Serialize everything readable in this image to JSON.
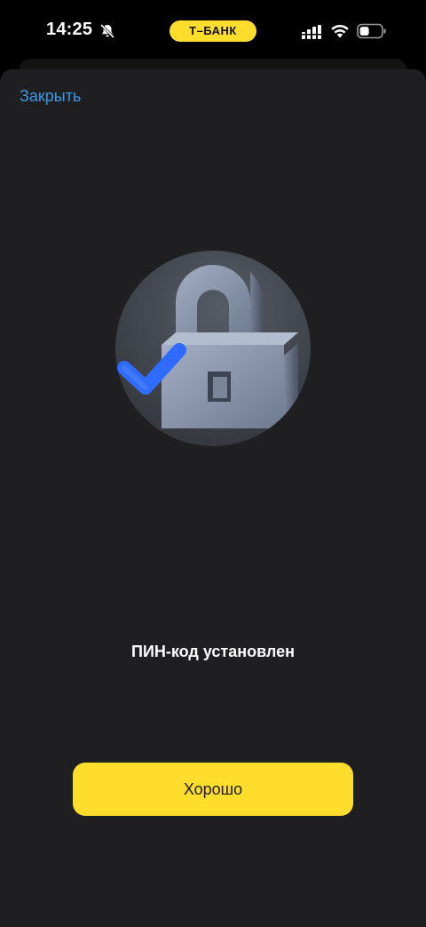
{
  "status_bar": {
    "time": "14:25",
    "carrier": "Т–БАНК",
    "icons": [
      "bell-muted-icon",
      "signal-icon",
      "wifi-icon",
      "battery-icon"
    ]
  },
  "sheet": {
    "close_label": "Закрыть",
    "illustration": "lock-with-checkmark-icon",
    "title": "ПИН-код установлен",
    "primary_button_label": "Хорошо"
  },
  "colors": {
    "accent_yellow": "#FFDD2D",
    "link_blue": "#3A98E6",
    "sheet_background": "#1F1F21",
    "check_blue": "#2F6BFF"
  }
}
